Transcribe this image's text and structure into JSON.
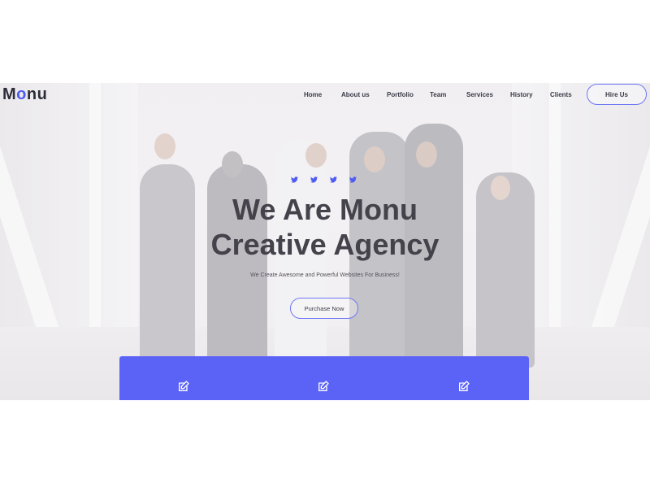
{
  "brand": {
    "logo_prefix": "M",
    "logo_o": "o",
    "logo_suffix": "nu"
  },
  "nav": {
    "items": [
      {
        "label": "Home"
      },
      {
        "label": "About us"
      },
      {
        "label": "Portfolio"
      },
      {
        "label": "Team"
      },
      {
        "label": "Services"
      },
      {
        "label": "History"
      },
      {
        "label": "Clients"
      }
    ],
    "cta_label": "Hire Us"
  },
  "hero": {
    "social_icons": [
      "twitter-icon",
      "twitter-icon",
      "twitter-icon",
      "twitter-icon"
    ],
    "title_line1": "We Are Monu",
    "title_line2": "Creative Agency",
    "subtitle": "We Create Awesome and Powerful Websites For Business!",
    "cta_label": "Purchase Now"
  },
  "features": {
    "icons": [
      "edit-icon",
      "edit-icon",
      "edit-icon"
    ]
  },
  "colors": {
    "accent": "#4e5bf2",
    "feature_bar": "#5b63f6",
    "heading": "#44424a"
  }
}
